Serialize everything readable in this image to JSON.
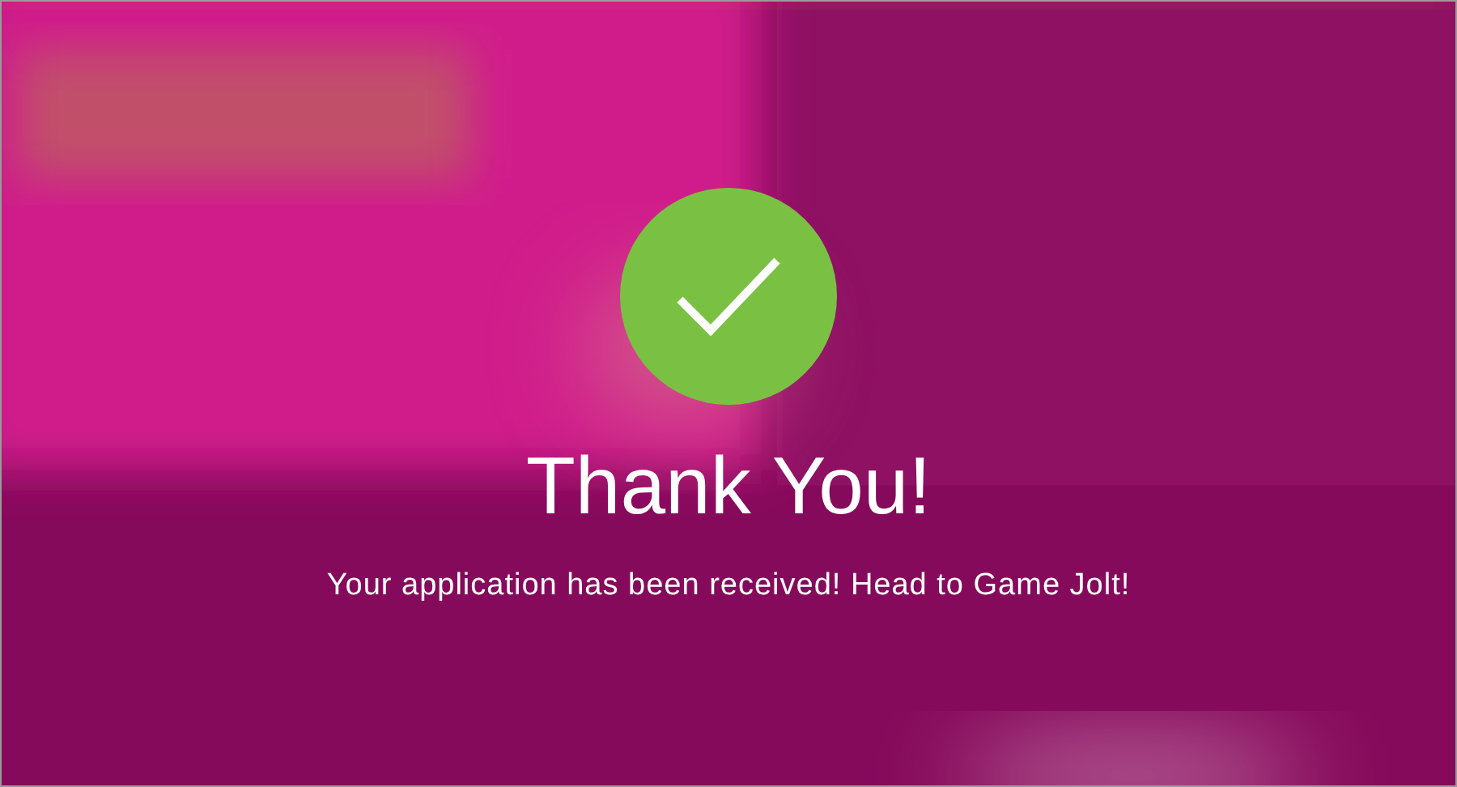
{
  "confirmation": {
    "title": "Thank You!",
    "message": "Your application has been received! Head to Game Jolt!"
  }
}
